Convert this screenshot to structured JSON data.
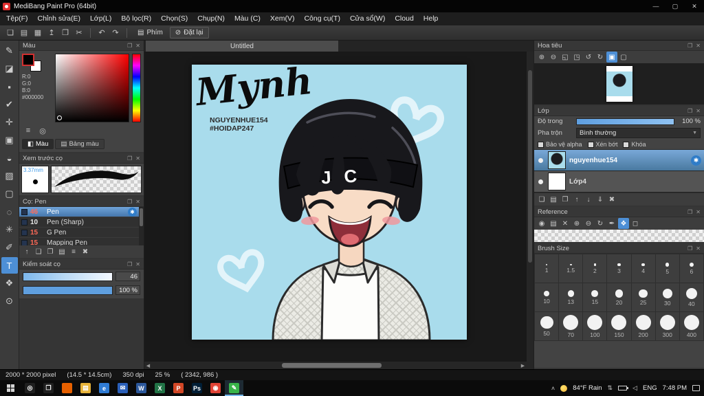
{
  "colors": {
    "accent": "#4d8fd6",
    "selection": "#4577ad",
    "canvas_bg": "#a9dcec",
    "titlebar": "#050505"
  },
  "titlebar": {
    "title": "MediBang Paint Pro (64bit)",
    "minimize": "—",
    "maximize": "▢",
    "close": "✕"
  },
  "menubar": {
    "items": [
      "Tệp(F)",
      "Chỉnh sửa(E)",
      "Lớp(L)",
      "Bộ lọc(R)",
      "Chọn(S)",
      "Chụp(N)",
      "Màu (C)",
      "Xem(V)",
      "Công cụ(T)",
      "Cửa sổ(W)",
      "Cloud",
      "Help"
    ]
  },
  "toolbar": {
    "file_icons": [
      {
        "name": "new-file-icon",
        "glyph": "❏"
      },
      {
        "name": "open-file-icon",
        "glyph": "▤"
      },
      {
        "name": "save-icon",
        "glyph": "▦"
      },
      {
        "name": "export-icon",
        "glyph": "↥"
      },
      {
        "name": "copy-icon",
        "glyph": "❐"
      },
      {
        "name": "cut-icon",
        "glyph": "✂"
      }
    ],
    "history_icons": [
      {
        "name": "undo-icon",
        "glyph": "↶"
      },
      {
        "name": "redo-icon",
        "glyph": "↷"
      }
    ],
    "key_label": "Phím",
    "reset_label": "Đặt lại"
  },
  "tool_strip": {
    "tools": [
      {
        "name": "brush-tool",
        "glyph": "✎"
      },
      {
        "name": "eraser-tool",
        "glyph": "◪"
      },
      {
        "name": "dot-pen-tool",
        "glyph": "▪"
      },
      {
        "name": "select-pen-tool",
        "glyph": "✔"
      },
      {
        "name": "move-tool",
        "glyph": "✛"
      },
      {
        "name": "fill-rect-tool",
        "glyph": "▣"
      },
      {
        "name": "bucket-tool",
        "glyph": "◒"
      },
      {
        "name": "gradient-tool",
        "glyph": "▨"
      },
      {
        "name": "select-rect-tool",
        "glyph": "▢"
      },
      {
        "name": "lasso-tool",
        "glyph": "◌"
      },
      {
        "name": "magic-wand-tool",
        "glyph": "✳"
      },
      {
        "name": "pen-tool",
        "glyph": "✐"
      },
      {
        "name": "text-tool",
        "glyph": "T",
        "active": true
      },
      {
        "name": "hand-tool",
        "glyph": "❖"
      },
      {
        "name": "zoom-tool",
        "glyph": "⊙"
      }
    ]
  },
  "color_panel": {
    "title": "Màu",
    "r": "R:0",
    "g": "G:0",
    "b": "B:0",
    "hex": "#000000",
    "view_icons": [
      {
        "name": "color-sliders-icon",
        "glyph": "≡"
      },
      {
        "name": "color-wheel-icon",
        "glyph": "◎"
      }
    ],
    "tab_color": "Màu",
    "tab_palette": "Bảng màu"
  },
  "brush_preview_panel": {
    "title": "Xem trước cọ",
    "size_label": "3.37mm"
  },
  "brush_panel": {
    "title": "Cọ: Pen",
    "brushes": [
      {
        "size": "46",
        "name": "Pen",
        "size_color": "#ff6a58",
        "selected": true
      },
      {
        "size": "10",
        "name": "Pen (Sharp)",
        "size_color": "#e8e8e8"
      },
      {
        "size": "15",
        "name": "G Pen",
        "size_color": "#ff6a58"
      },
      {
        "size": "15",
        "name": "Mapping Pen",
        "size_color": "#ff6a58"
      }
    ],
    "tool_icons": [
      {
        "name": "brush-up-icon",
        "glyph": "↑"
      },
      {
        "name": "add-brush-icon",
        "glyph": "❏"
      },
      {
        "name": "duplicate-brush-icon",
        "glyph": "❐"
      },
      {
        "name": "brush-folder-icon",
        "glyph": "▤"
      },
      {
        "name": "brush-menu-icon",
        "glyph": "≡"
      },
      {
        "name": "delete-brush-icon",
        "glyph": "✖"
      }
    ]
  },
  "brush_control_panel": {
    "title": "Kiểm soát cọ",
    "size_value": "46",
    "opacity_value": "100 %"
  },
  "canvas": {
    "tab_title": "Untitled",
    "artwork": {
      "title_text": "Mynh",
      "credit1": "NGUYENHUE154",
      "credit2": "#HOIDAP247",
      "headband_text": "JAC"
    }
  },
  "navigator_panel": {
    "title": "Hoa tiêu",
    "icons": [
      {
        "name": "zoom-in-icon",
        "glyph": "⊕"
      },
      {
        "name": "zoom-out-icon",
        "glyph": "⊖"
      },
      {
        "name": "zoom-fit-icon",
        "glyph": "◱"
      },
      {
        "name": "zoom-actual-icon",
        "glyph": "◳"
      },
      {
        "name": "rotate-left-icon",
        "glyph": "↺"
      },
      {
        "name": "rotate-right-icon",
        "glyph": "↻"
      },
      {
        "name": "nav-thumbnail-button",
        "glyph": "▣",
        "active": true
      },
      {
        "name": "nav-reset-icon",
        "glyph": "▢"
      }
    ]
  },
  "layer_panel": {
    "title": "Lớp",
    "opacity_label": "Độ trong",
    "opacity_value": "100 %",
    "blend_label": "Pha trộn",
    "blend_value": "Bình thường",
    "check_alpha": "Bảo vệ alpha",
    "check_clip": "Xén bớt",
    "check_lock": "Khóa",
    "layers": [
      {
        "name": "nguyenhue154",
        "selected": true
      },
      {
        "name": "Lớp4"
      }
    ],
    "tool_icons": [
      {
        "name": "add-layer-icon",
        "glyph": "❏"
      },
      {
        "name": "add-folder-icon",
        "glyph": "▤"
      },
      {
        "name": "duplicate-layer-icon",
        "glyph": "❐"
      },
      {
        "name": "layer-up-icon",
        "glyph": "↑"
      },
      {
        "name": "layer-down-icon",
        "glyph": "↓"
      },
      {
        "name": "merge-layer-icon",
        "glyph": "⇓"
      },
      {
        "name": "delete-layer-icon",
        "glyph": "✖"
      }
    ]
  },
  "reference_panel": {
    "title": "Reference",
    "icons": [
      {
        "name": "show-reference-icon",
        "glyph": "◉"
      },
      {
        "name": "open-reference-icon",
        "glyph": "▤"
      },
      {
        "name": "clear-reference-icon",
        "glyph": "✕"
      },
      {
        "name": "ref-zoom-in-icon",
        "glyph": "⊕"
      },
      {
        "name": "ref-zoom-out-icon",
        "glyph": "⊖"
      },
      {
        "name": "ref-rotate-icon",
        "glyph": "↻"
      },
      {
        "name": "ref-eyedropper-icon",
        "glyph": "✒"
      },
      {
        "name": "ref-hand-icon",
        "glyph": "❖",
        "active": true
      },
      {
        "name": "ref-reset-icon",
        "glyph": "◻"
      }
    ]
  },
  "brush_size_panel": {
    "title": "Brush Size",
    "sizes": [
      "1",
      "1.5",
      "2",
      "3",
      "4",
      "5",
      "6",
      "10",
      "13",
      "15",
      "20",
      "25",
      "30",
      "40",
      "50",
      "70",
      "100",
      "150",
      "200",
      "300",
      "400"
    ]
  },
  "status_bar": {
    "dimensions": "2000 * 2000 pixel",
    "size_cm": "(14.5 * 14.5cm)",
    "dpi": "350 dpi",
    "zoom": "25 %",
    "coords": "( 2342, 986 )"
  },
  "taskbar": {
    "apps": [
      {
        "name": "app-cortana",
        "glyph": "◎",
        "color": "#1f1f1f"
      },
      {
        "name": "app-task-view",
        "glyph": "❐",
        "color": "#1f1f1f"
      },
      {
        "name": "app-firefox",
        "glyph": "",
        "color": "#e66000"
      },
      {
        "name": "app-file-explorer",
        "glyph": "▤",
        "color": "#e8b43a"
      },
      {
        "name": "app-edge",
        "glyph": "e",
        "color": "#2f7bd4"
      },
      {
        "name": "app-mail",
        "glyph": "✉",
        "color": "#2a5fb8"
      },
      {
        "name": "app-word",
        "glyph": "W",
        "color": "#2b579a"
      },
      {
        "name": "app-excel",
        "glyph": "X",
        "color": "#217346"
      },
      {
        "name": "app-powerpoint",
        "glyph": "P",
        "color": "#d24726"
      },
      {
        "name": "app-photoshop",
        "glyph": "Ps",
        "color": "#001e36"
      },
      {
        "name": "app-chrome",
        "glyph": "◉",
        "color": "#e04335"
      },
      {
        "name": "app-medibang",
        "glyph": "✎",
        "color": "#39b54a",
        "active": true
      }
    ],
    "weather": "84°F Rain",
    "language": "ENG",
    "time": "7:48 PM"
  }
}
